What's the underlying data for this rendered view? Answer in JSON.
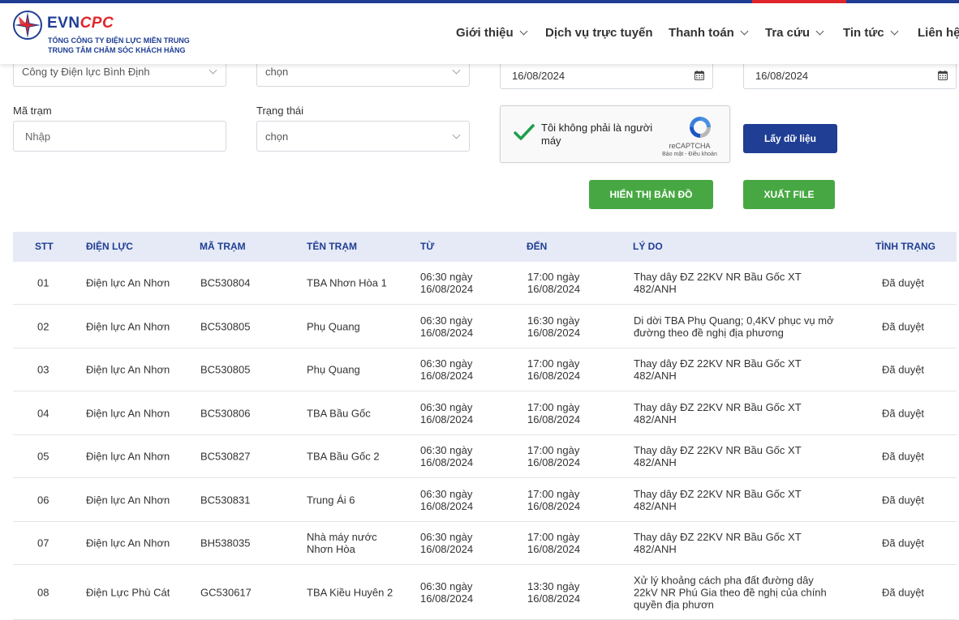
{
  "header": {
    "logo_brand_evn": "EVN",
    "logo_brand_cpc": "CPC",
    "logo_line1": "TỔNG CÔNG TY ĐIỆN LỰC MIỀN TRUNG",
    "logo_line2": "TRUNG TÂM CHĂM SÓC KHÁCH HÀNG",
    "nav": [
      {
        "label": "Giới thiệu"
      },
      {
        "label": "Dịch vụ trực tuyến"
      },
      {
        "label": "Thanh toán"
      },
      {
        "label": "Tra cứu"
      },
      {
        "label": "Tin tức"
      },
      {
        "label": "Liên hệ"
      }
    ]
  },
  "form": {
    "company_value": "Công ty Điện lực Bình Định",
    "unit_value": "chọn",
    "date_from": "16/08/2024",
    "date_to": "16/08/2024",
    "station_label": "Mã trạm",
    "station_placeholder": "Nhập",
    "status_label": "Trạng thái",
    "status_value": "chọn",
    "captcha_text": "Tôi không phải là người máy",
    "captcha_brand": "reCAPTCHA",
    "captcha_terms": "Bảo mật - Điều khoản",
    "fetch_button": "Lấy dữ liệu",
    "map_button": "HIỂN THỊ BẢN ĐỒ",
    "export_button": "XUẤT FILE"
  },
  "table": {
    "headers": {
      "stt": "STT",
      "dien_luc": "ĐIỆN LỰC",
      "ma_tram": "MÃ TRẠM",
      "ten_tram": "TÊN TRẠM",
      "tu": "TỪ",
      "den": "ĐẾN",
      "ly_do": "LÝ DO",
      "tinh_trang": "TÌNH TRẠNG"
    },
    "rows": [
      {
        "stt": "01",
        "dien_luc": "Điện lực An Nhơn",
        "ma_tram": "BC530804",
        "ten_tram": "TBA Nhơn Hòa 1",
        "tu": "06:30 ngày\n16/08/2024",
        "den": "17:00 ngày\n16/08/2024",
        "ly_do": "Thay dây ĐZ 22KV NR Bầu Gốc XT\n482/ANH",
        "tinh_trang": "Đã duyệt"
      },
      {
        "stt": "02",
        "dien_luc": "Điện lực An Nhơn",
        "ma_tram": "BC530805",
        "ten_tram": "Phụ Quang",
        "tu": "06:30 ngày\n16/08/2024",
        "den": "16:30 ngày\n16/08/2024",
        "ly_do": "Di dời TBA Phụ Quang; 0,4KV phục vụ mở\nđường theo đề nghị địa phương",
        "tinh_trang": "Đã duyệt"
      },
      {
        "stt": "03",
        "dien_luc": "Điện lực An Nhơn",
        "ma_tram": "BC530805",
        "ten_tram": "Phụ Quang",
        "tu": "06:30 ngày\n16/08/2024",
        "den": "17:00 ngày\n16/08/2024",
        "ly_do": "Thay dây ĐZ 22KV NR Bầu Gốc XT\n482/ANH",
        "tinh_trang": "Đã duyệt"
      },
      {
        "stt": "04",
        "dien_luc": "Điện lực An Nhơn",
        "ma_tram": "BC530806",
        "ten_tram": "TBA Bầu Gốc",
        "tu": "06:30 ngày\n16/08/2024",
        "den": "17:00 ngày\n16/08/2024",
        "ly_do": "Thay dây ĐZ 22KV NR Bầu Gốc XT\n482/ANH",
        "tinh_trang": "Đã duyệt"
      },
      {
        "stt": "05",
        "dien_luc": "Điện lực An Nhơn",
        "ma_tram": "BC530827",
        "ten_tram": "TBA Bầu Gốc 2",
        "tu": "06:30 ngày\n16/08/2024",
        "den": "17:00 ngày\n16/08/2024",
        "ly_do": "Thay dây ĐZ 22KV NR Bầu Gốc XT\n482/ANH",
        "tinh_trang": "Đã duyệt"
      },
      {
        "stt": "06",
        "dien_luc": "Điện lực An Nhơn",
        "ma_tram": "BC530831",
        "ten_tram": "Trung Ái 6",
        "tu": "06:30 ngày\n16/08/2024",
        "den": "17:00 ngày\n16/08/2024",
        "ly_do": "Thay dây ĐZ 22KV NR Bầu Gốc XT\n482/ANH",
        "tinh_trang": "Đã duyệt"
      },
      {
        "stt": "07",
        "dien_luc": "Điện lực An Nhơn",
        "ma_tram": "BH538035",
        "ten_tram": "Nhà máy nước\nNhơn Hòa",
        "tu": "06:30 ngày\n16/08/2024",
        "den": "17:00 ngày\n16/08/2024",
        "ly_do": "Thay dây ĐZ 22KV NR Bầu Gốc XT\n482/ANH",
        "tinh_trang": "Đã duyệt"
      },
      {
        "stt": "08",
        "dien_luc": "Điện Lực Phù Cát",
        "ma_tram": "GC530617",
        "ten_tram": "TBA Kiều Huyên 2",
        "tu": "06:30 ngày\n16/08/2024",
        "den": "13:30 ngày\n16/08/2024",
        "ly_do": "Xử lý khoảng cách pha đất đường dây\n22kV NR Phú Gia theo đề nghị của chính\nquyền địa phươn",
        "tinh_trang": "Đã duyệt"
      }
    ]
  }
}
